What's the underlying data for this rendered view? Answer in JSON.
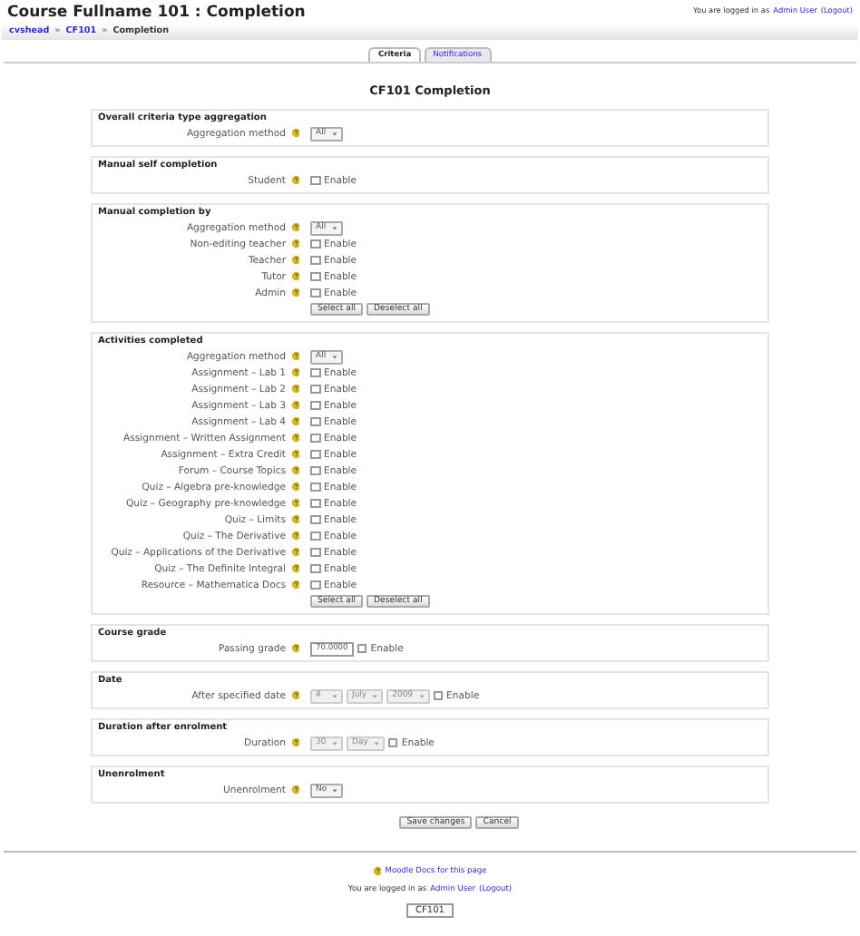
{
  "header": {
    "title": "Course Fullname 101 : Completion",
    "login_prefix": "You are logged in as",
    "login_user": "Admin User",
    "login_logout": "(Logout)"
  },
  "breadcrumb": {
    "separator": "»",
    "items": [
      {
        "label": "cvshead",
        "link": true
      },
      {
        "label": "CF101",
        "link": true
      },
      {
        "label": "Completion",
        "link": false
      }
    ]
  },
  "tabs": [
    {
      "label": "Criteria",
      "selected": true
    },
    {
      "label": "Notifications",
      "selected": false
    }
  ],
  "heading": "CF101 Completion",
  "sections": [
    {
      "title": "Overall criteria type aggregation",
      "rows": [
        {
          "kind": "select",
          "label": "Aggregation method",
          "value": "All"
        }
      ]
    },
    {
      "title": "Manual self completion",
      "rows": [
        {
          "kind": "checkbox",
          "label": "Student",
          "option": "Enable",
          "checked": false
        }
      ]
    },
    {
      "title": "Manual completion by",
      "rows": [
        {
          "kind": "select",
          "label": "Aggregation method",
          "value": "All"
        },
        {
          "kind": "checkbox",
          "label": "Non-editing teacher",
          "option": "Enable",
          "checked": false
        },
        {
          "kind": "checkbox",
          "label": "Teacher",
          "option": "Enable",
          "checked": false
        },
        {
          "kind": "checkbox",
          "label": "Tutor",
          "option": "Enable",
          "checked": false
        },
        {
          "kind": "checkbox",
          "label": "Admin",
          "option": "Enable",
          "checked": false
        },
        {
          "kind": "buttons",
          "buttons": [
            "Select all",
            "Deselect all"
          ]
        }
      ]
    },
    {
      "title": "Activities completed",
      "rows": [
        {
          "kind": "select",
          "label": "Aggregation method",
          "value": "All"
        },
        {
          "kind": "checkbox",
          "label": "Assignment – Lab 1",
          "option": "Enable",
          "checked": false
        },
        {
          "kind": "checkbox",
          "label": "Assignment – Lab 2",
          "option": "Enable",
          "checked": false
        },
        {
          "kind": "checkbox",
          "label": "Assignment – Lab 3",
          "option": "Enable",
          "checked": false
        },
        {
          "kind": "checkbox",
          "label": "Assignment – Lab 4",
          "option": "Enable",
          "checked": false
        },
        {
          "kind": "checkbox",
          "label": "Assignment – Written Assignment",
          "option": "Enable",
          "checked": false
        },
        {
          "kind": "checkbox",
          "label": "Assignment – Extra Credit",
          "option": "Enable",
          "checked": false
        },
        {
          "kind": "checkbox",
          "label": "Forum – Course Topics",
          "option": "Enable",
          "checked": false
        },
        {
          "kind": "checkbox",
          "label": "Quiz – Algebra pre-knowledge",
          "option": "Enable",
          "checked": false
        },
        {
          "kind": "checkbox",
          "label": "Quiz – Geography pre-knowledge",
          "option": "Enable",
          "checked": false
        },
        {
          "kind": "checkbox",
          "label": "Quiz – Limits",
          "option": "Enable",
          "checked": false
        },
        {
          "kind": "checkbox",
          "label": "Quiz – The Derivative",
          "option": "Enable",
          "checked": false
        },
        {
          "kind": "checkbox",
          "label": "Quiz – Applications of the Derivative",
          "option": "Enable",
          "checked": false
        },
        {
          "kind": "checkbox",
          "label": "Quiz – The Definite Integral",
          "option": "Enable",
          "checked": false
        },
        {
          "kind": "checkbox",
          "label": "Resource – Mathematica Docs",
          "option": "Enable",
          "checked": false
        },
        {
          "kind": "buttons",
          "buttons": [
            "Select all",
            "Deselect all"
          ]
        }
      ]
    },
    {
      "title": "Course grade",
      "rows": [
        {
          "kind": "text",
          "label": "Passing grade",
          "value": "70.0000",
          "option": "Enable",
          "checked": false
        }
      ]
    },
    {
      "title": "Date",
      "rows": [
        {
          "kind": "multiselect",
          "label": "After specified date",
          "values": [
            "4",
            "July",
            "2009"
          ],
          "disabled": true,
          "option": "Enable",
          "checked": false
        }
      ]
    },
    {
      "title": "Duration after enrolment",
      "rows": [
        {
          "kind": "multiselect",
          "label": "Duration",
          "values": [
            "30",
            "Day"
          ],
          "disabled": true,
          "option": "Enable",
          "checked": false
        }
      ]
    },
    {
      "title": "Unenrolment",
      "rows": [
        {
          "kind": "select",
          "label": "Unenrolment",
          "value": "No"
        }
      ]
    }
  ],
  "form_buttons": [
    "Save changes",
    "Cancel"
  ],
  "footer": {
    "docs_link": "Moodle Docs for this page",
    "login_prefix": "You are logged in as",
    "login_user": "Admin User",
    "login_logout": "(Logout)",
    "course_button": "CF101"
  }
}
